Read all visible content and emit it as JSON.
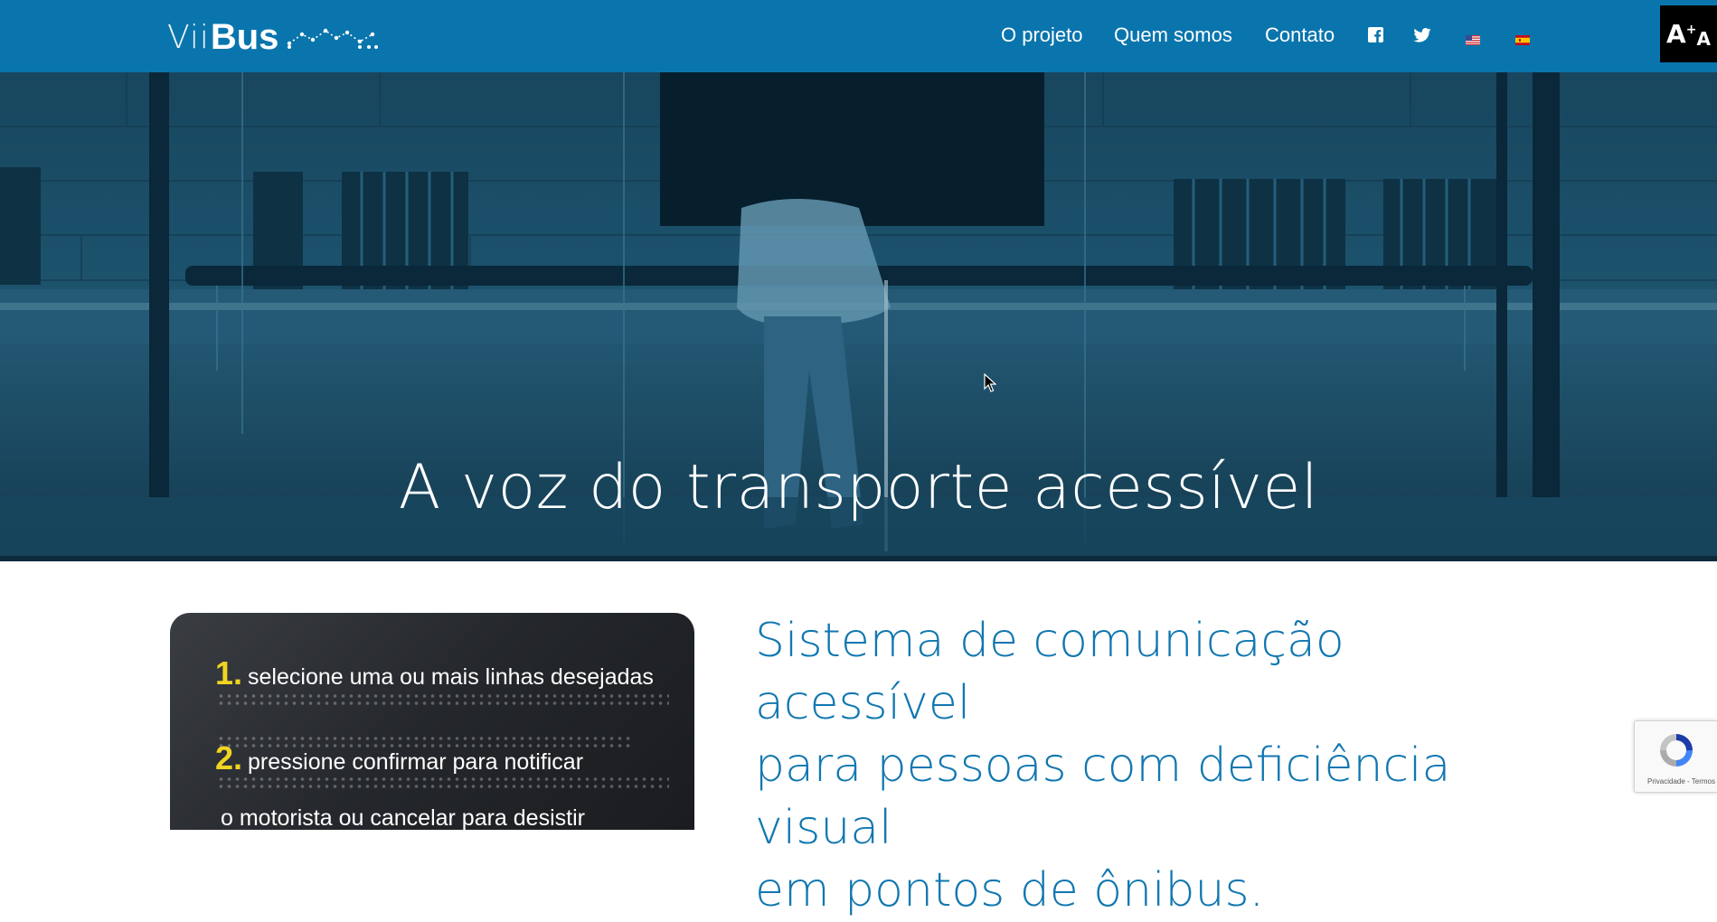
{
  "header": {
    "logo": {
      "vii": "Vii",
      "bus": "Bus"
    },
    "nav": [
      {
        "label": "O projeto"
      },
      {
        "label": "Quem somos"
      },
      {
        "label": "Contato"
      }
    ],
    "icons": [
      "facebook-icon",
      "twitter-icon",
      "flag-us-icon",
      "flag-es-icon"
    ],
    "accessibility_button_icon": "font-size-toggle-icon",
    "colors": {
      "bar": "#0a75ad",
      "text": "#ffffff"
    }
  },
  "hero": {
    "title": "A voz do transporte acessível"
  },
  "instructions_card": {
    "steps": [
      {
        "number": "1.",
        "text": "selecione uma ou mais linhas desejadas"
      },
      {
        "number": "2.",
        "text": "pressione confirmar para notificar"
      },
      {
        "number": "",
        "text": "o motorista ou cancelar para desistir"
      }
    ]
  },
  "main": {
    "headline_lines": [
      "Sistema de comunicação acessível",
      "para pessoas com deficiência visual",
      "em pontos de ônibus."
    ],
    "accent": "#1177b0"
  },
  "recaptcha": {
    "terms": "Privacidade - Termos"
  }
}
